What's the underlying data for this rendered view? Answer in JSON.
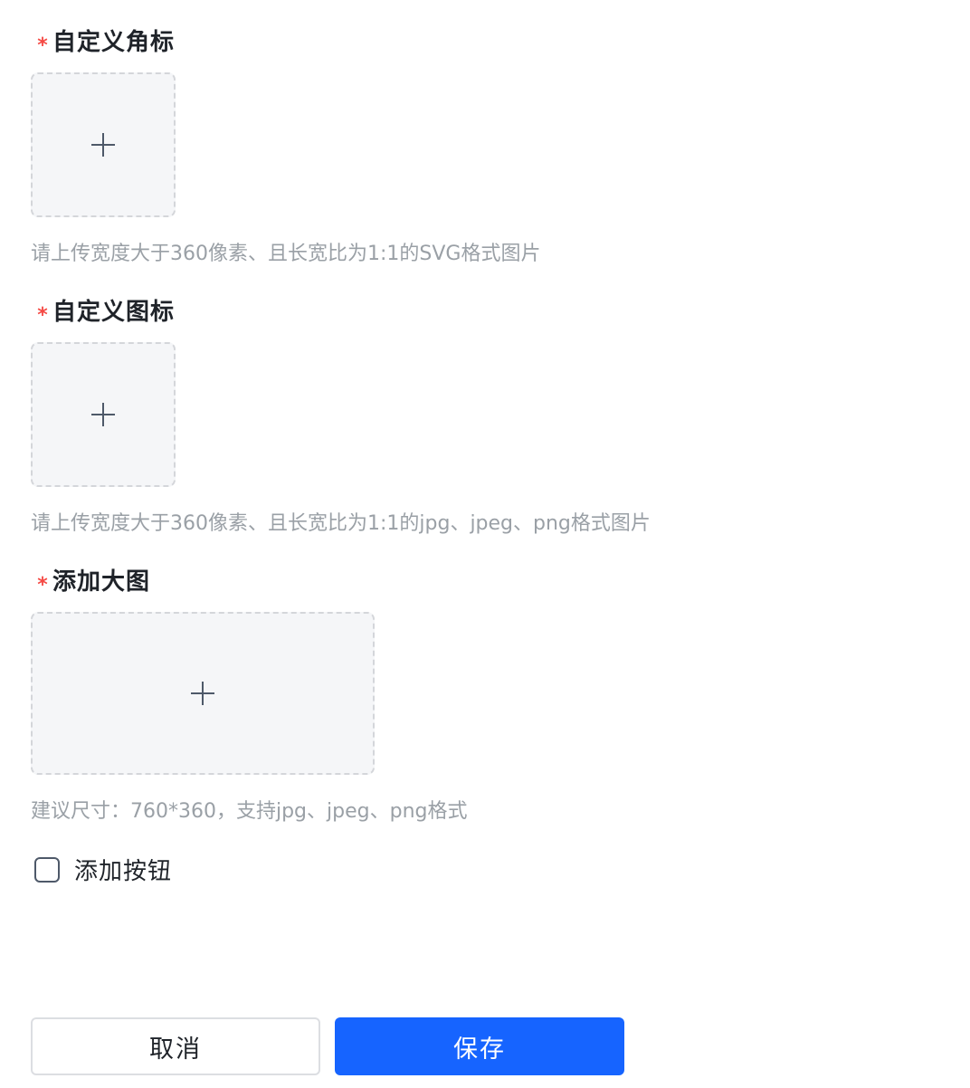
{
  "required_mark": "*",
  "sections": [
    {
      "label": "自定义角标",
      "hint": "请上传宽度大于360像素、且长宽比为1:1的SVG格式图片"
    },
    {
      "label": "自定义图标",
      "hint": "请上传宽度大于360像素、且长宽比为1:1的jpg、jpeg、png格式图片"
    },
    {
      "label": "添加大图",
      "hint": "建议尺寸：760*360，支持jpg、jpeg、png格式"
    }
  ],
  "add_button_checkbox": {
    "label": "添加按钮",
    "checked": false
  },
  "footer": {
    "cancel_label": "取消",
    "save_label": "保存"
  },
  "colors": {
    "primary": "#1664ff",
    "required": "#f54a45",
    "upload_bg": "#f5f6f8"
  }
}
